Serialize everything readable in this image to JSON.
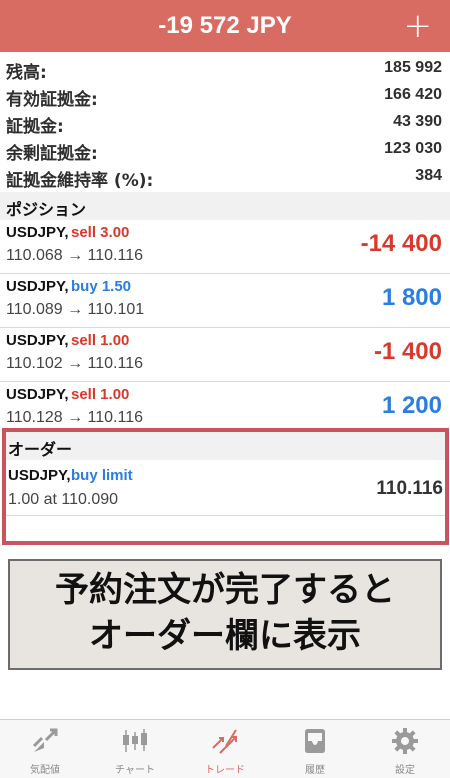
{
  "header": {
    "title": "-19 572 JPY",
    "add_label": "+"
  },
  "summary": [
    {
      "label": "残高:",
      "value": "185 992"
    },
    {
      "label": "有効証拠金:",
      "value": "166 420"
    },
    {
      "label": "証拠金:",
      "value": "43 390"
    },
    {
      "label": "余剰証拠金:",
      "value": "123 030"
    },
    {
      "label": "証拠金維持率 (%):",
      "value": "384"
    }
  ],
  "positions": {
    "heading": "ポジション",
    "items": [
      {
        "symbol": "USDJPY,",
        "side": "sell 3.00",
        "prices": "110.068 → 110.116",
        "profit": "-14 400",
        "side_color": "#d8392b",
        "profit_color": "#d8392b"
      },
      {
        "symbol": "USDJPY,",
        "side": "buy 1.50",
        "prices": "110.089 → 110.101",
        "profit": "1 800",
        "side_color": "#2a7de1",
        "profit_color": "#2a7de1"
      },
      {
        "symbol": "USDJPY,",
        "side": "sell 1.00",
        "prices": "110.102 → 110.116",
        "profit": "-1 400",
        "side_color": "#d8392b",
        "profit_color": "#d8392b"
      },
      {
        "symbol": "USDJPY,",
        "side": "sell 1.00",
        "prices": "110.128 → 110.116",
        "profit": "1 200",
        "side_color": "#d8392b",
        "profit_color": "#2a7de1"
      }
    ]
  },
  "orders": {
    "heading": "オーダー",
    "items": [
      {
        "symbol": "USDJPY,",
        "type": "buy limit",
        "detail": "1.00 at 110.090",
        "price": "110.116"
      }
    ]
  },
  "caption": {
    "line1": "予約注文が完了すると",
    "line2": "オーダー欄に表示"
  },
  "tabs": [
    {
      "label": "気配値",
      "icon": "quotes-icon"
    },
    {
      "label": "チャート",
      "icon": "chart-icon"
    },
    {
      "label": "トレード",
      "icon": "trade-icon",
      "active": true
    },
    {
      "label": "履歴",
      "icon": "history-icon"
    },
    {
      "label": "設定",
      "icon": "settings-icon"
    }
  ],
  "colors": {
    "accent": "#d96c62",
    "loss": "#d8392b",
    "profit": "#2a7de1",
    "highlight_border": "#c9555a"
  }
}
